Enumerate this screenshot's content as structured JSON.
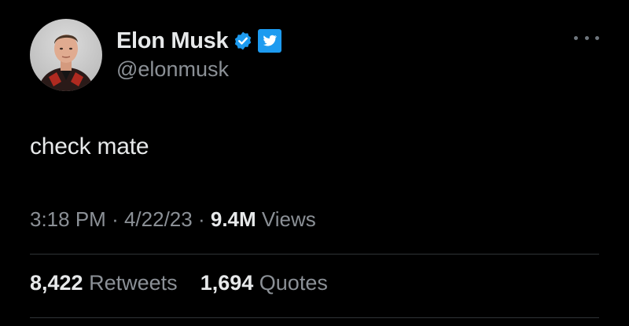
{
  "author": {
    "display_name": "Elon Musk",
    "handle": "@elonmusk",
    "verified": true,
    "verified_color": "#1d9bf0",
    "affiliate_badge_icon": "twitter-bird-icon",
    "affiliate_badge_color": "#1d9bf0"
  },
  "tweet": {
    "text": "check mate"
  },
  "meta": {
    "time": "3:18 PM",
    "separator_1": "·",
    "date": "4/22/23",
    "separator_2": "·",
    "views_count": "9.4M",
    "views_label": "Views"
  },
  "stats": {
    "retweets_count": "8,422",
    "retweets_label": "Retweets",
    "quotes_count": "1,694",
    "quotes_label": "Quotes"
  },
  "icons": {
    "more": "more-horizontal-icon",
    "verified": "verified-badge-icon"
  }
}
